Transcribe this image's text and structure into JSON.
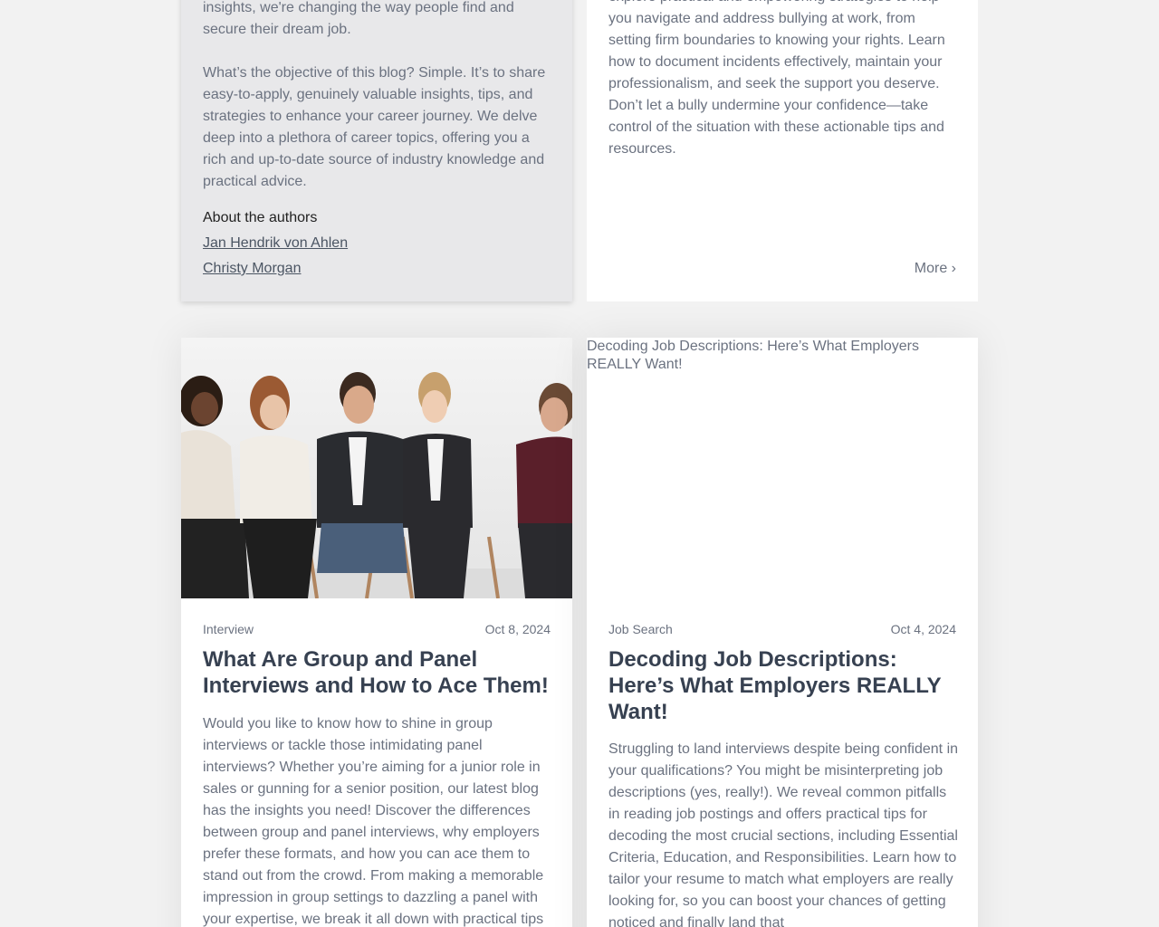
{
  "about_card": {
    "paragraph_1": "insights, we're changing the way people find and secure their dream job.",
    "paragraph_2": "What’s the objective of this blog? Simple. It’s to share easy-to-apply, genuinely valuable insights, tips, and strategies to enhance your career journey. We delve deep into a plethora of career topics, offering you a rich and up-to-date source of industry knowledge and practical advice.",
    "authors_title": "About the authors",
    "authors": [
      "Jan Hendrik von Ahlen",
      "Christy Morgan"
    ]
  },
  "bully_card": {
    "excerpt": "explore practical and empowering strategies to help you navigate and address bullying at work, from setting firm boundaries to knowing your rights. Learn how to document incidents effectively, maintain your professionalism, and seek the support you deserve. Don’t let a bully undermine your confidence—take control of the situation with these actionable tips and resources.",
    "more_label": "More ›"
  },
  "group_card": {
    "category": "Interview",
    "date": "Oct 8, 2024",
    "title": "What Are Group and Panel Interviews and How to Ace Them!",
    "excerpt": "Would you like to know how to shine in group interviews or tackle those intimidating panel interviews? Whether you’re aiming for a junior role in sales or gunning for a senior position, our latest blog has the insights you need! Discover the differences between group and panel interviews, why employers prefer these formats, and how you can ace them to stand out from the crowd. From making a memorable impression in group settings to dazzling a panel with your expertise, we break it all down with practical tips"
  },
  "decode_card": {
    "image_alt": "Decoding Job Descriptions: Here’s What Employers REALLY Want!",
    "category": "Job Search",
    "date": "Oct 4, 2024",
    "title": "Decoding Job Descriptions: Here’s What Employers REALLY Want!",
    "excerpt": "Struggling to land interviews despite being confident in your qualifications? You might be misinterpreting job descriptions (yes, really!). We reveal common pitfalls in reading job postings and offers practical tips for decoding the most crucial sections, including Essential Criteria, Education, and Responsibilities. Learn how to tailor your resume to match what employers are really looking for, so you can boost your chances of getting noticed and finally land that"
  }
}
